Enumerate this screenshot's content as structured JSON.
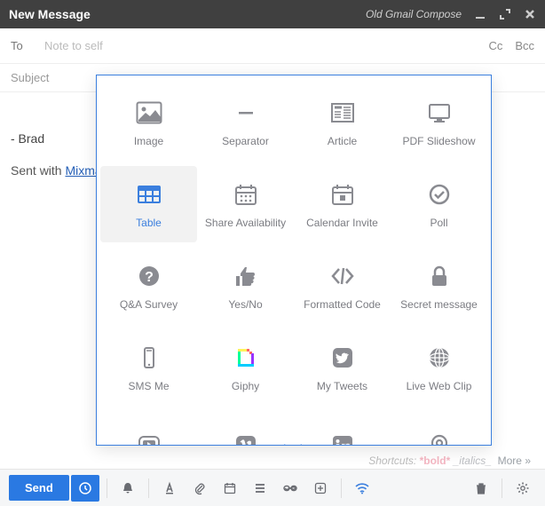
{
  "titleBar": {
    "title": "New Message",
    "oldLink": "Old Gmail Compose"
  },
  "to": {
    "label": "To",
    "placeholder": "Note to self",
    "ccLabel": "Cc",
    "bccLabel": "Bcc"
  },
  "subject": {
    "placeholder": "Subject"
  },
  "body": {
    "signature": "- Brad",
    "sentWithPrefix": "Sent with ",
    "sentWithLink": "Mixma"
  },
  "popover": {
    "items": [
      {
        "id": "image",
        "label": "Image"
      },
      {
        "id": "separator",
        "label": "Separator"
      },
      {
        "id": "article",
        "label": "Article"
      },
      {
        "id": "pdf-slideshow",
        "label": "PDF Slideshow"
      },
      {
        "id": "table",
        "label": "Table",
        "selected": true
      },
      {
        "id": "share-availability",
        "label": "Share Availability"
      },
      {
        "id": "calendar-invite",
        "label": "Calendar Invite"
      },
      {
        "id": "poll",
        "label": "Poll"
      },
      {
        "id": "qa-survey",
        "label": "Q&A Survey"
      },
      {
        "id": "yesno",
        "label": "Yes/No"
      },
      {
        "id": "formatted-code",
        "label": "Formatted Code"
      },
      {
        "id": "secret-message",
        "label": "Secret message"
      },
      {
        "id": "sms-me",
        "label": "SMS Me"
      },
      {
        "id": "giphy",
        "label": "Giphy"
      },
      {
        "id": "my-tweets",
        "label": "My Tweets"
      },
      {
        "id": "live-web-clip",
        "label": "Live Web Clip"
      },
      {
        "id": "youtube",
        "label": ""
      },
      {
        "id": "vimeo",
        "label": ""
      },
      {
        "id": "linkedin",
        "label": ""
      },
      {
        "id": "location",
        "label": ""
      }
    ]
  },
  "shortcuts": {
    "label": "Shortcuts:",
    "bold": "*bold*",
    "italics": "_italics_",
    "more": "More »"
  },
  "toolbar": {
    "sendLabel": "Send"
  }
}
